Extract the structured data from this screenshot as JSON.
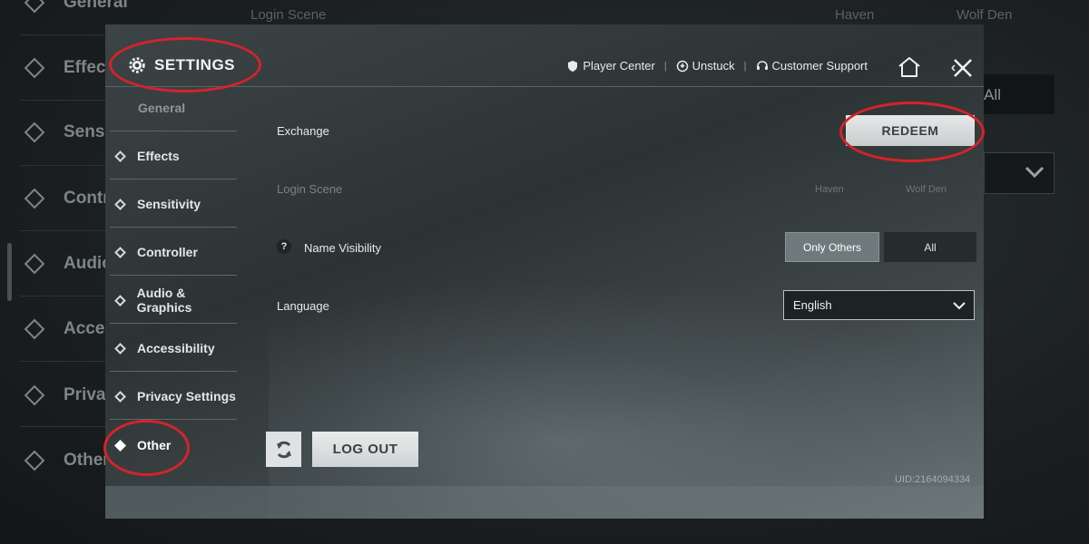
{
  "background": {
    "items": [
      "General",
      "Effec",
      "Sensi",
      "Contr",
      "Audio",
      "Acce",
      "Priva",
      "Other"
    ],
    "login_scene": "Login Scene",
    "haven": "Haven",
    "wolf_den": "Wolf Den",
    "all": "All"
  },
  "header": {
    "title": "SETTINGS",
    "links": [
      "Player Center",
      "Unstuck",
      "Customer Support"
    ]
  },
  "sidebar": {
    "partial_item": "General",
    "items": [
      {
        "label": "Effects"
      },
      {
        "label": "Sensitivity"
      },
      {
        "label": "Controller"
      },
      {
        "label": "Audio & Graphics"
      },
      {
        "label": "Accessibility"
      },
      {
        "label": "Privacy Settings"
      },
      {
        "label": "Other"
      }
    ],
    "active": "Other"
  },
  "content": {
    "exchange": {
      "label": "Exchange",
      "button": "REDEEM"
    },
    "login_scene": {
      "label": "Login Scene",
      "options": [
        "Haven",
        "Wolf Den"
      ]
    },
    "name_visibility": {
      "help": "?",
      "label": "Name Visibility",
      "options": [
        "Only Others",
        "All"
      ],
      "selected": "Only Others"
    },
    "language": {
      "label": "Language",
      "value": "English"
    },
    "logout": "LOG OUT",
    "uid": "UID:2164094334"
  },
  "colors": {
    "annotation": "#d4232b",
    "panel": "#3a4143"
  }
}
